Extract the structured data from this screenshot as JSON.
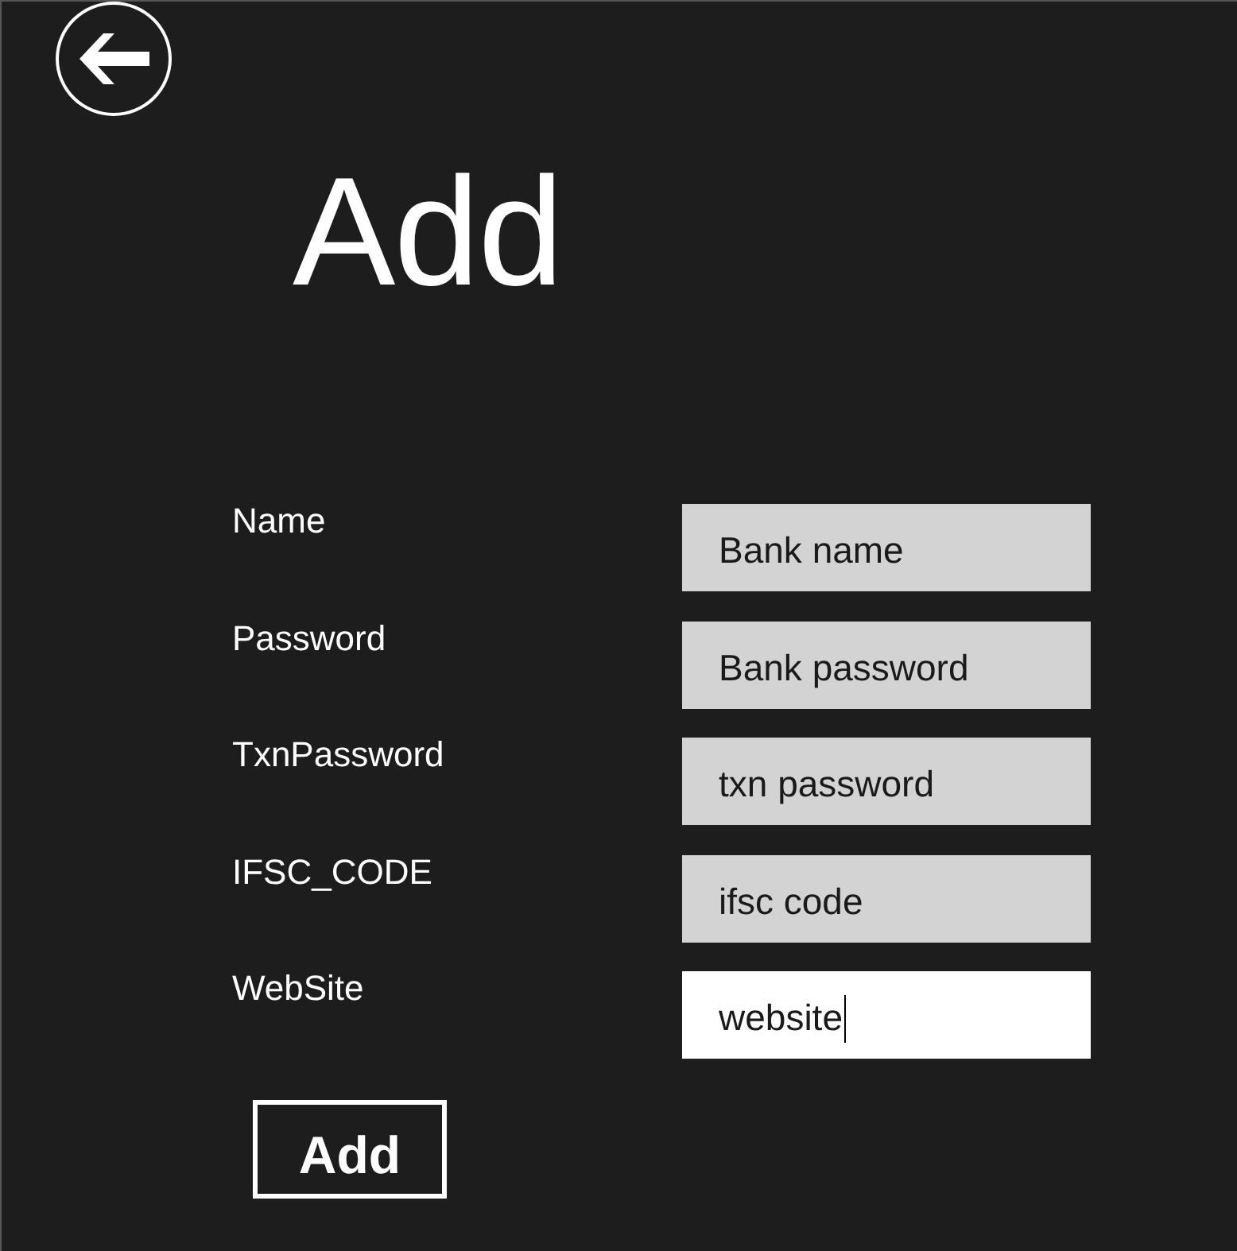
{
  "title": "Add",
  "fields": [
    {
      "label": "Name",
      "value": "Bank name",
      "focused": false
    },
    {
      "label": "Password",
      "value": "Bank password",
      "focused": false
    },
    {
      "label": "TxnPassword",
      "value": "txn password",
      "focused": false
    },
    {
      "label": "IFSC_CODE",
      "value": "ifsc code",
      "focused": false
    },
    {
      "label": "WebSite",
      "value": "website",
      "focused": true
    }
  ],
  "submit_button": {
    "label": "Add"
  }
}
